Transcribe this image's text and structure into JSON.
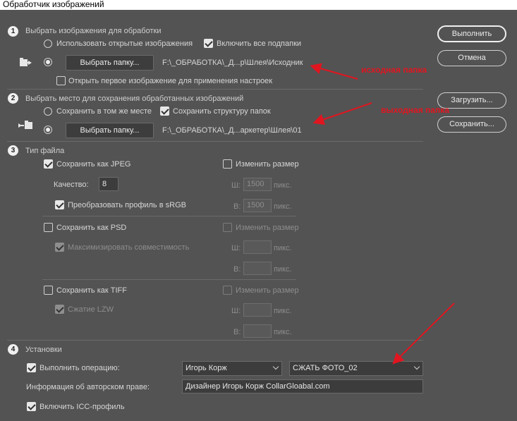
{
  "window": {
    "title": "Обработчик изображений"
  },
  "section1": {
    "number": "1",
    "title": "Выбрать изображения для обработки",
    "use_open_label": "Использовать открытые изображения",
    "include_subfolders_label": "Включить все подпапки",
    "folder_button": "Выбрать папку...",
    "folder_path": "F:\\_ОБРАБОТКА\\_Д...р\\Шлея\\Исходник",
    "open_first_label": "Открыть первое изображение для применения настроек"
  },
  "section2": {
    "number": "2",
    "title": "Выбрать место для сохранения обработанных изображений",
    "same_place_label": "Сохранить в том же месте",
    "keep_structure_label": "Сохранить структуру папок",
    "folder_button": "Выбрать папку...",
    "folder_path": "F:\\_ОБРАБОТКА\\_Д...аркетер\\Шлея\\01"
  },
  "section3": {
    "number": "3",
    "title": "Тип файла",
    "jpeg": {
      "save_label": "Сохранить как JPEG",
      "resize_label": "Изменить размер",
      "quality_label": "Качество:",
      "quality_value": "8",
      "srgb_label": "Преобразовать профиль в sRGB",
      "w_label": "Ш:",
      "w_value": "1500",
      "w_unit": "пикс.",
      "h_label": "В:",
      "h_value": "1500",
      "h_unit": "пикс."
    },
    "psd": {
      "save_label": "Сохранить как PSD",
      "resize_label": "Изменить размер",
      "compat_label": "Максимизировать совместимость",
      "w_label": "Ш:",
      "w_unit": "пикс.",
      "h_label": "В:",
      "h_unit": "пикс."
    },
    "tiff": {
      "save_label": "Сохранить как TIFF",
      "resize_label": "Изменить размер",
      "lzw_label": "Сжатие LZW",
      "w_label": "Ш:",
      "w_unit": "пикс.",
      "h_label": "В:",
      "h_unit": "пикс."
    }
  },
  "section4": {
    "number": "4",
    "title": "Установки",
    "run_action_label": "Выполнить операцию:",
    "action_set": "Игорь Корж",
    "action": "СЖАТЬ ФОТО_02",
    "copyright_label": "Информация об авторском праве:",
    "copyright_value": "Дизайнер Игорь Корж CollarGloabal.com",
    "icc_label": "Включить ICC-профиль"
  },
  "buttons": {
    "run": "Выполнить",
    "cancel": "Отмена",
    "load": "Загрузить...",
    "save": "Сохранить..."
  },
  "annotations": {
    "source": "исходная папка",
    "output": "выходная папка"
  },
  "colors": {
    "annotation": "#e0151f",
    "background": "#535353"
  }
}
